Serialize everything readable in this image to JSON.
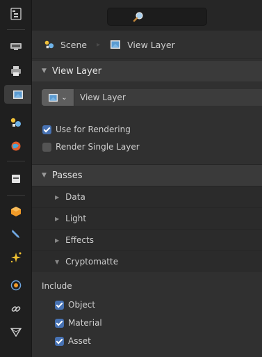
{
  "search": {
    "placeholder": ""
  },
  "sidebar_tabs": [
    {
      "name": "tool-tab",
      "icon": "tool-settings-icon"
    },
    {
      "name": "render-tab",
      "icon": "render-icon"
    },
    {
      "name": "output-tab",
      "icon": "printer-icon"
    },
    {
      "name": "view-layer-tab",
      "icon": "view-layer-icon",
      "active": true
    },
    {
      "name": "scene-tab",
      "icon": "scene-icon"
    },
    {
      "name": "world-tab",
      "icon": "world-icon"
    },
    {
      "name": "collection-tab",
      "icon": "collection-icon"
    },
    {
      "name": "object-tab",
      "icon": "object-icon"
    },
    {
      "name": "modifiers-tab",
      "icon": "wrench-icon"
    },
    {
      "name": "particles-tab",
      "icon": "particles-icon"
    },
    {
      "name": "physics-tab",
      "icon": "physics-icon"
    },
    {
      "name": "constraints-tab",
      "icon": "constraint-icon"
    },
    {
      "name": "data-tab",
      "icon": "mesh-data-icon"
    }
  ],
  "breadcrumb": {
    "scene": "Scene",
    "view_layer": "View Layer"
  },
  "view_layer_panel": {
    "title": "View Layer",
    "selector_value": "View Layer",
    "use_for_rendering": {
      "label": "Use for Rendering",
      "checked": true
    },
    "render_single_layer": {
      "label": "Render Single Layer",
      "checked": false
    }
  },
  "passes_panel": {
    "title": "Passes",
    "subpanels": [
      {
        "label": "Data",
        "expanded": false
      },
      {
        "label": "Light",
        "expanded": false
      },
      {
        "label": "Effects",
        "expanded": false
      },
      {
        "label": "Cryptomatte",
        "expanded": true
      }
    ]
  },
  "cryptomatte": {
    "include_label": "Include",
    "object": {
      "label": "Object",
      "checked": true
    },
    "material": {
      "label": "Material",
      "checked": true
    },
    "asset": {
      "label": "Asset",
      "checked": true
    }
  },
  "colors": {
    "accent": "#4772b3",
    "background": "#303030",
    "panel_header": "#3a3a3a"
  }
}
